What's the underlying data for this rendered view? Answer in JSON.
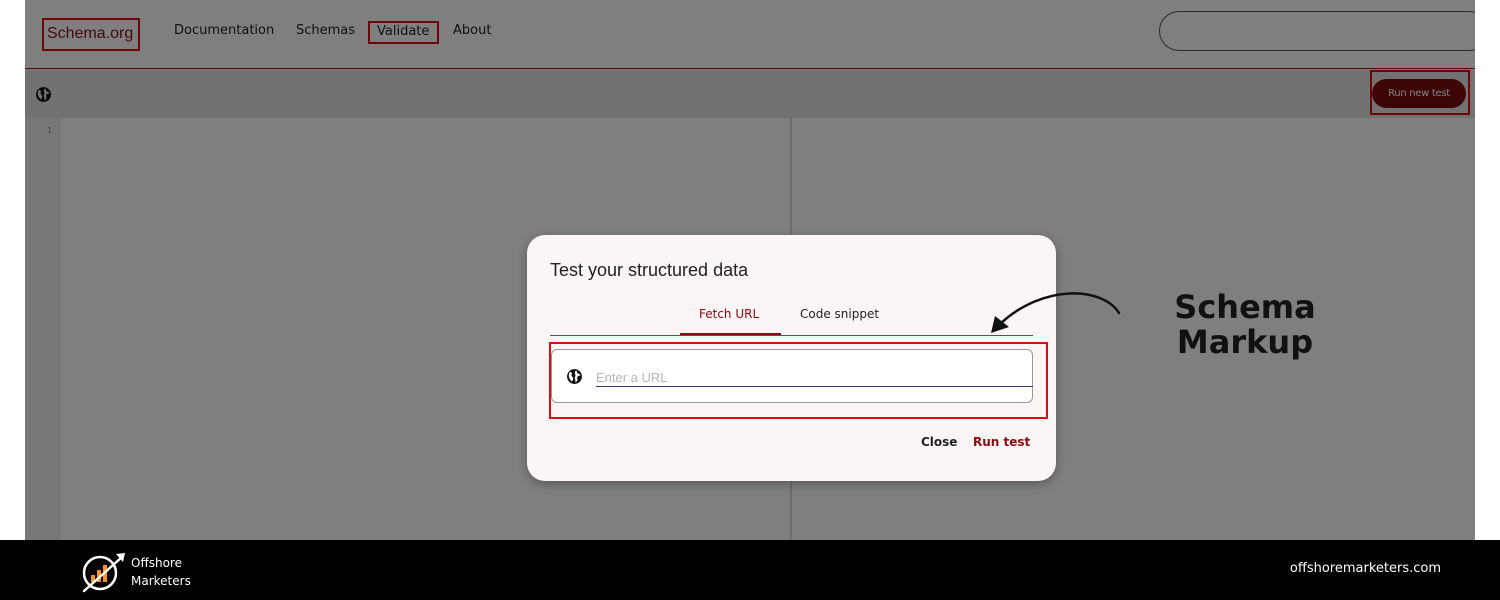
{
  "nav": {
    "logo": "Schema.org",
    "items": [
      "Documentation",
      "Schemas",
      "Validate",
      "About"
    ],
    "search_placeholder": ""
  },
  "toolbar": {
    "globe_icon": "globe-icon",
    "run_new_test_label": "Run new test"
  },
  "editor": {
    "line_number": "1"
  },
  "dialog": {
    "title": "Test your structured data",
    "tabs": [
      {
        "label": "Fetch URL",
        "active": true
      },
      {
        "label": "Code snippet",
        "active": false
      }
    ],
    "url_placeholder": "Enter a URL",
    "url_value": "",
    "close_label": "Close",
    "run_test_label": "Run test"
  },
  "annotation": {
    "line1": "Schema",
    "line2": "Markup"
  },
  "footer": {
    "brand_line1": "Offshore",
    "brand_line2": "Marketers",
    "url": "offshoremarketers.com"
  },
  "colors": {
    "accent": "#8a0a10",
    "highlight": "#e10b13",
    "footer_bg": "#000000",
    "logo_orange": "#f7941d"
  }
}
